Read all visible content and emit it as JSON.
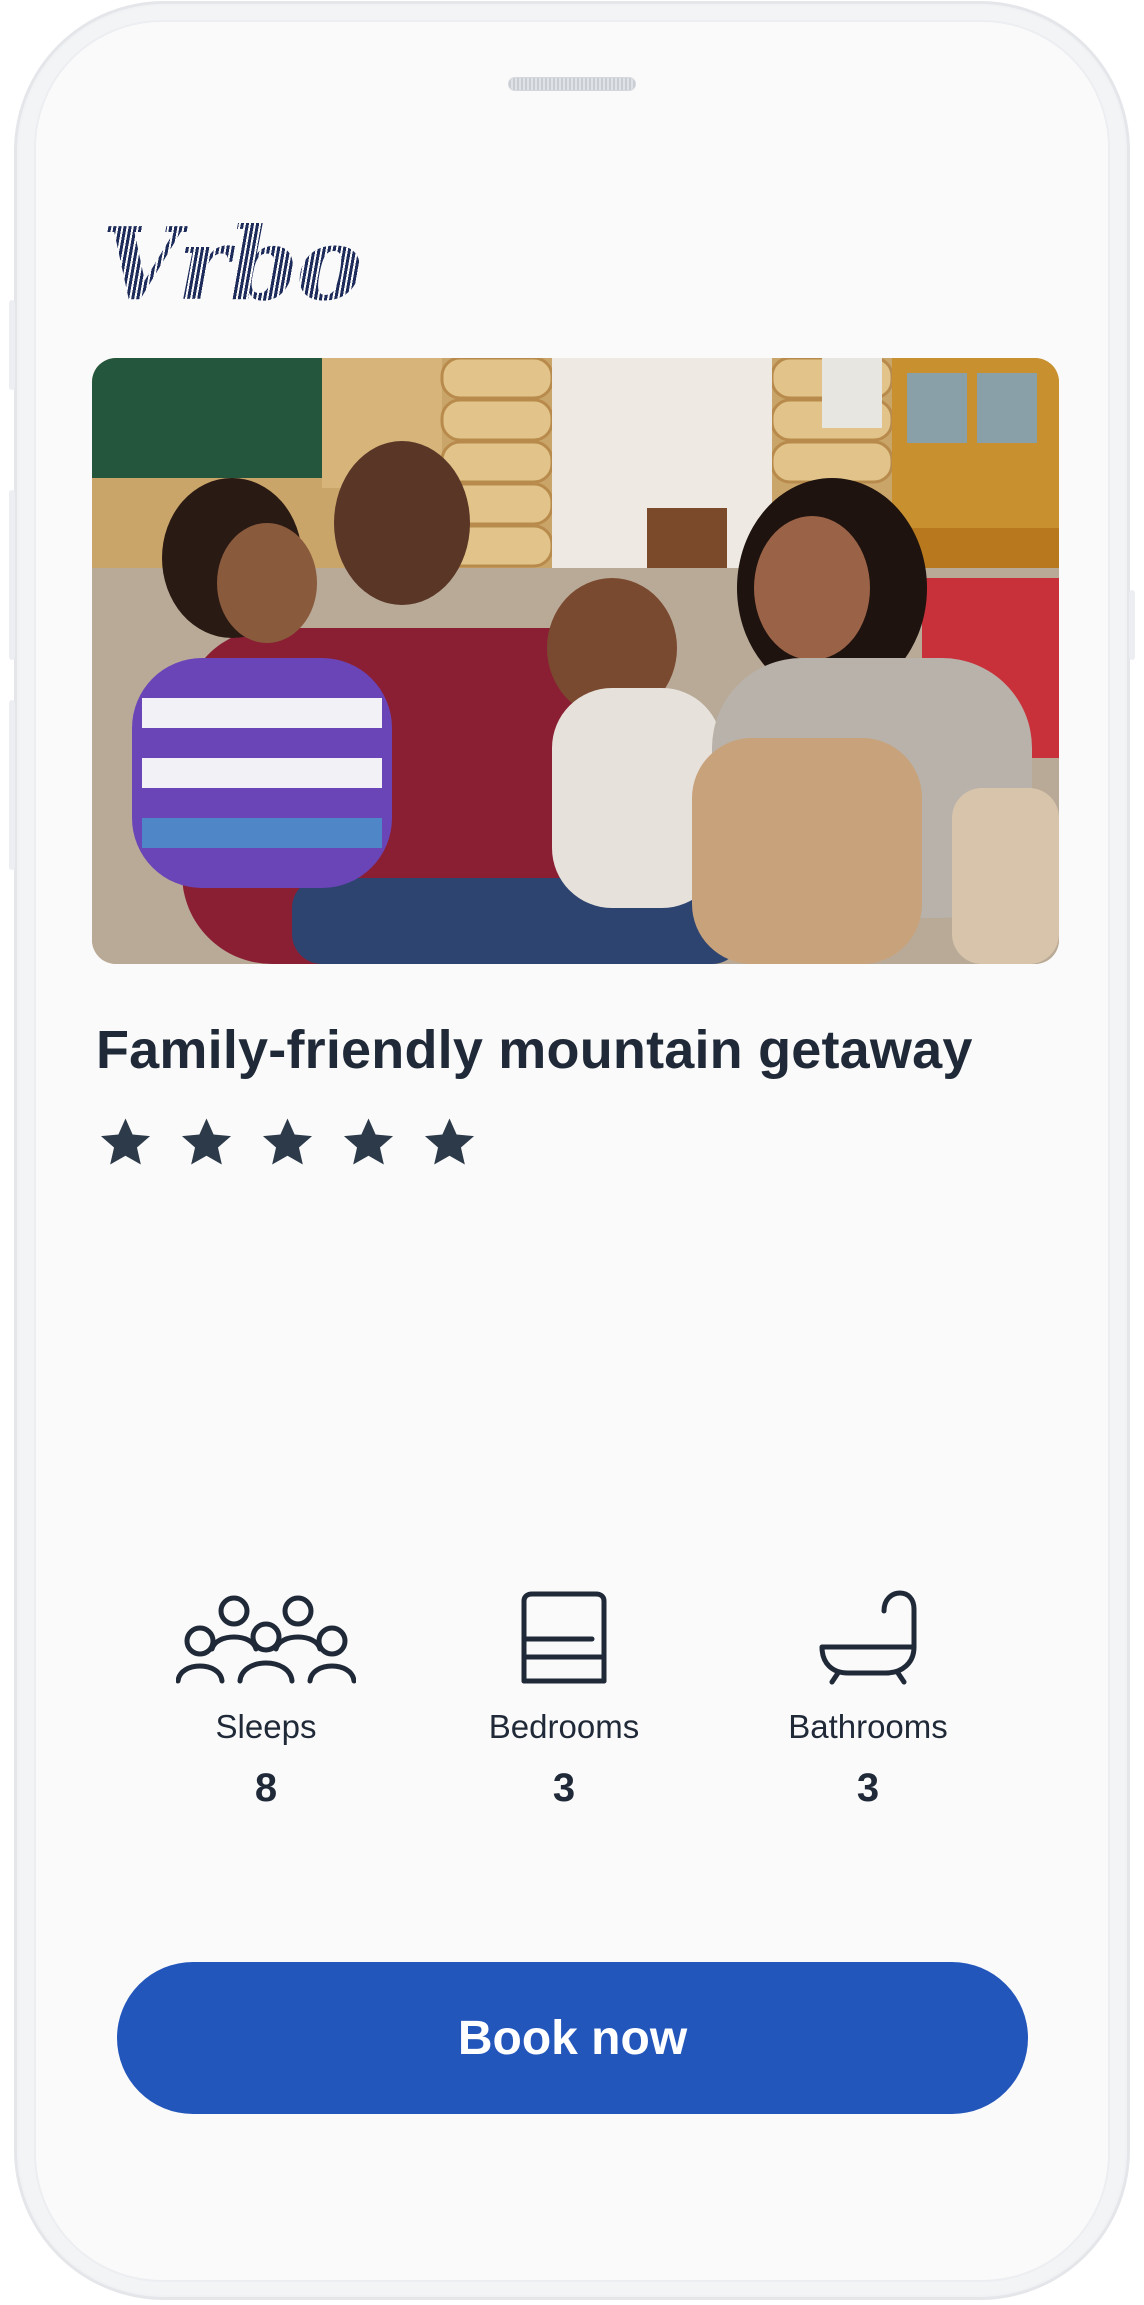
{
  "brand": {
    "logo_text": "Vrbo",
    "logo_color": "#1c2b5a"
  },
  "listing": {
    "image_alt": "Family laughing together on a couch in a log cabin",
    "title": "Family-friendly mountain getaway",
    "rating": 5,
    "rating_max": 5,
    "star_color": "#2d3a4a"
  },
  "amenities": [
    {
      "icon": "people-icon",
      "label": "Sleeps",
      "value": "8"
    },
    {
      "icon": "bed-icon",
      "label": "Bedrooms",
      "value": "3"
    },
    {
      "icon": "bathtub-icon",
      "label": "Bathrooms",
      "value": "3"
    }
  ],
  "cta": {
    "label": "Book now",
    "color": "#2356bb"
  }
}
